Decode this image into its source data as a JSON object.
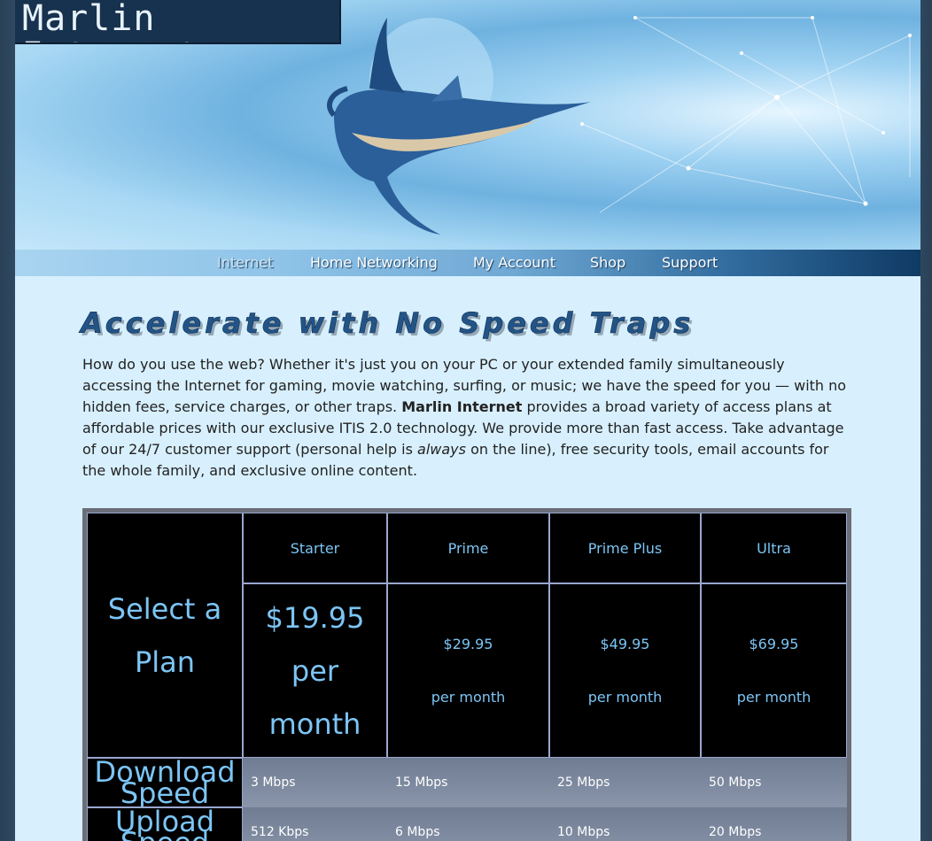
{
  "site": {
    "logo_text": "Marlin Internet"
  },
  "nav": {
    "items": [
      {
        "label": "Internet",
        "current": true
      },
      {
        "label": "Home Networking",
        "current": false
      },
      {
        "label": "My Account",
        "current": false
      },
      {
        "label": "Shop",
        "current": false
      },
      {
        "label": "Support",
        "current": false
      }
    ]
  },
  "headline": "Accelerate with No Speed Traps",
  "intro": {
    "part1": "How do you use the web? Whether it's just you on your PC or your extended family simultaneously accessing the Internet for gaming, movie watching, surfing, or music; we have the speed for you — with no hidden fees, service charges, or other traps.",
    "brand": "Marlin Internet",
    "part2": "provides a broad variety of access plans at affordable prices with our exclusive ITIS 2.0 technology. We provide more than fast access. Take advantage of our 24/7 customer support (personal help is",
    "emphasis": "always",
    "part3": "on the line), free security tools, email accounts for the whole family, and exclusive online content."
  },
  "plans": {
    "select_label": "Select a Plan",
    "names": [
      "Starter",
      "Prime",
      "Prime Plus",
      "Ultra"
    ],
    "prices": [
      "$19.95",
      "$29.95",
      "$49.95",
      "$69.95"
    ],
    "period": "per month",
    "rows": [
      {
        "label": "Download Speed",
        "values": [
          "3 Mbps",
          "15 Mbps",
          "25 Mbps",
          "50 Mbps"
        ]
      },
      {
        "label": "Upload Speed",
        "values": [
          "512 Kbps",
          "6 Mbps",
          "10 Mbps",
          "20 Mbps"
        ]
      }
    ]
  }
}
